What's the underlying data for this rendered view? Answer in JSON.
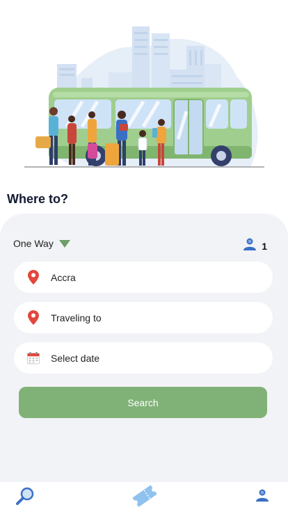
{
  "heading": "Where to?",
  "trip_type": {
    "selected": "One Way"
  },
  "passengers": {
    "count": "1"
  },
  "fields": {
    "origin": "Accra",
    "destination_placeholder": "Traveling to",
    "date_placeholder": "Select date"
  },
  "search_button": "Search",
  "icons": {
    "trip_dropdown": "triangle-down-icon",
    "passenger": "person-icon",
    "origin": "location-pin-icon",
    "destination": "location-pin-icon",
    "date": "calendar-icon",
    "nav_search": "magnifier-icon",
    "nav_tickets": "ticket-icon",
    "nav_profile": "person-icon"
  },
  "colors": {
    "accent_green": "#80b277",
    "card_background": "#f2f3f6",
    "pin_red": "#e3473c",
    "icon_blue": "#3a6fc4"
  }
}
